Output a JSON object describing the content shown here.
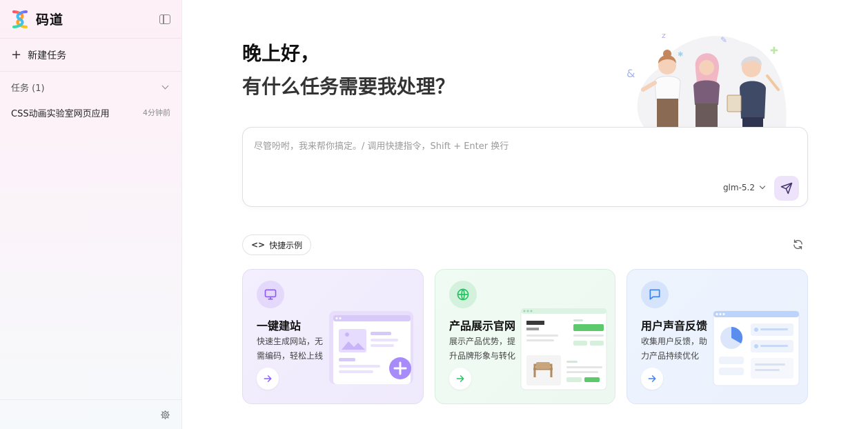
{
  "sidebar": {
    "brand": "码道",
    "new_task_label": "新建任务",
    "tasks_header": "任务 (1)",
    "tasks": [
      {
        "title": "CSS动画实验室网页应用",
        "time": "4分钟前"
      }
    ]
  },
  "main": {
    "greeting_line1": "晚上好，",
    "greeting_line2": "有什么任务需要我处理？",
    "composer": {
      "placeholder": "尽管吩咐，我来帮你搞定。/ 调用快捷指令，Shift + Enter 换行",
      "model": "glm-5.2"
    },
    "examples_label": "快捷示例",
    "cards": [
      {
        "title": "一键建站",
        "desc": "快速生成网站，无需编码，轻松上线",
        "accent": "#8b5cf6"
      },
      {
        "title": "产品展示官网",
        "desc": "展示产品优势，提升品牌形象与转化",
        "accent": "#22c55e"
      },
      {
        "title": "用户声音反馈",
        "desc": "收集用户反馈，助力产品持续优化",
        "accent": "#3b82f6"
      }
    ]
  },
  "colors": {
    "sidebar_bg": "#fdf0f6",
    "send_bg": "#ede4fb",
    "accent_purple": "#8b5cf6",
    "accent_green": "#22c55e",
    "accent_blue": "#3b82f6"
  },
  "icons": {
    "logo": "logo-icon",
    "sidebar_toggle": "sidebar-toggle-icon",
    "new_task": "plus-icon",
    "settings": "gear-icon",
    "send": "send-icon",
    "refresh": "refresh-icon",
    "card1": "monitor-icon",
    "card2": "globe-icon",
    "card3": "chat-icon"
  }
}
